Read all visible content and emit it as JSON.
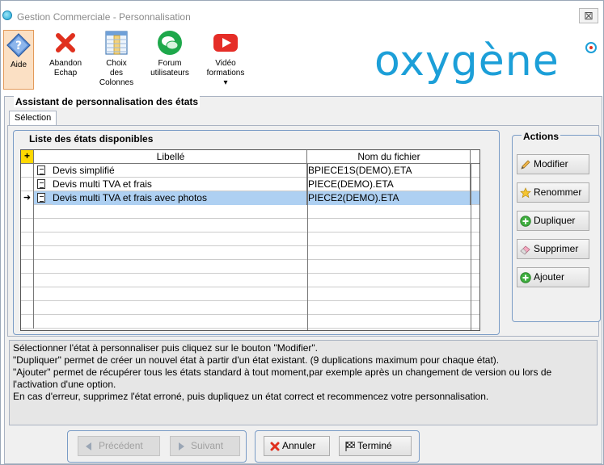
{
  "window": {
    "title": "Gestion Commerciale - Personnalisation",
    "close_label": "⊠"
  },
  "ribbon": {
    "aide": "Aide",
    "abandon_line1": "Abandon",
    "abandon_line2": "Echap",
    "choix_line1": "Choix",
    "choix_line2": "des",
    "choix_line3": "Colonnes",
    "forum_line1": "Forum",
    "forum_line2": "utilisateurs",
    "video_line1": "Vidéo",
    "video_line2": "formations",
    "video_dropdown": "▾"
  },
  "brand": {
    "logo_text": "oxygène",
    "color": "#1c9fd8"
  },
  "wizard": {
    "title": "Assistant de personnalisation des états",
    "tab": "Sélection"
  },
  "list": {
    "title": "Liste des états disponibles",
    "corner_label": "+",
    "col_libelle": "Libellé",
    "col_fichier": "Nom du fichier",
    "rows": [
      {
        "libelle": "Devis simplifié",
        "fichier": "BPIECE1S(DEMO).ETA",
        "selected": false
      },
      {
        "libelle": "Devis multi TVA et frais",
        "fichier": "PIECE(DEMO).ETA",
        "selected": false
      },
      {
        "libelle": "Devis multi TVA et frais avec photos",
        "fichier": "PIECE2(DEMO).ETA",
        "selected": true
      }
    ],
    "selected_marker": "➜"
  },
  "actions": {
    "title": "Actions",
    "modifier": "Modifier",
    "renommer": "Renommer",
    "dupliquer": "Dupliquer",
    "supprimer": "Supprimer",
    "ajouter": "Ajouter"
  },
  "info": {
    "line1": "Sélectionner l'état à personnaliser puis cliquez sur le bouton \"Modifier\".",
    "line2": "\"Dupliquer\" permet de créer un nouvel état à partir d'un état existant. (9 duplications maximum pour chaque état).",
    "line3": "\"Ajouter\" permet de récupérer tous les états standard à tout moment,par exemple après un changement de version ou lors de l'activation d'une option.",
    "line4": "En cas d'erreur, supprimez l'état erroné, puis dupliquez un état correct et recommencez votre personnalisation."
  },
  "footer": {
    "precedent": "Précédent",
    "suivant": "Suivant",
    "annuler": "Annuler",
    "termine": "Terminé"
  }
}
